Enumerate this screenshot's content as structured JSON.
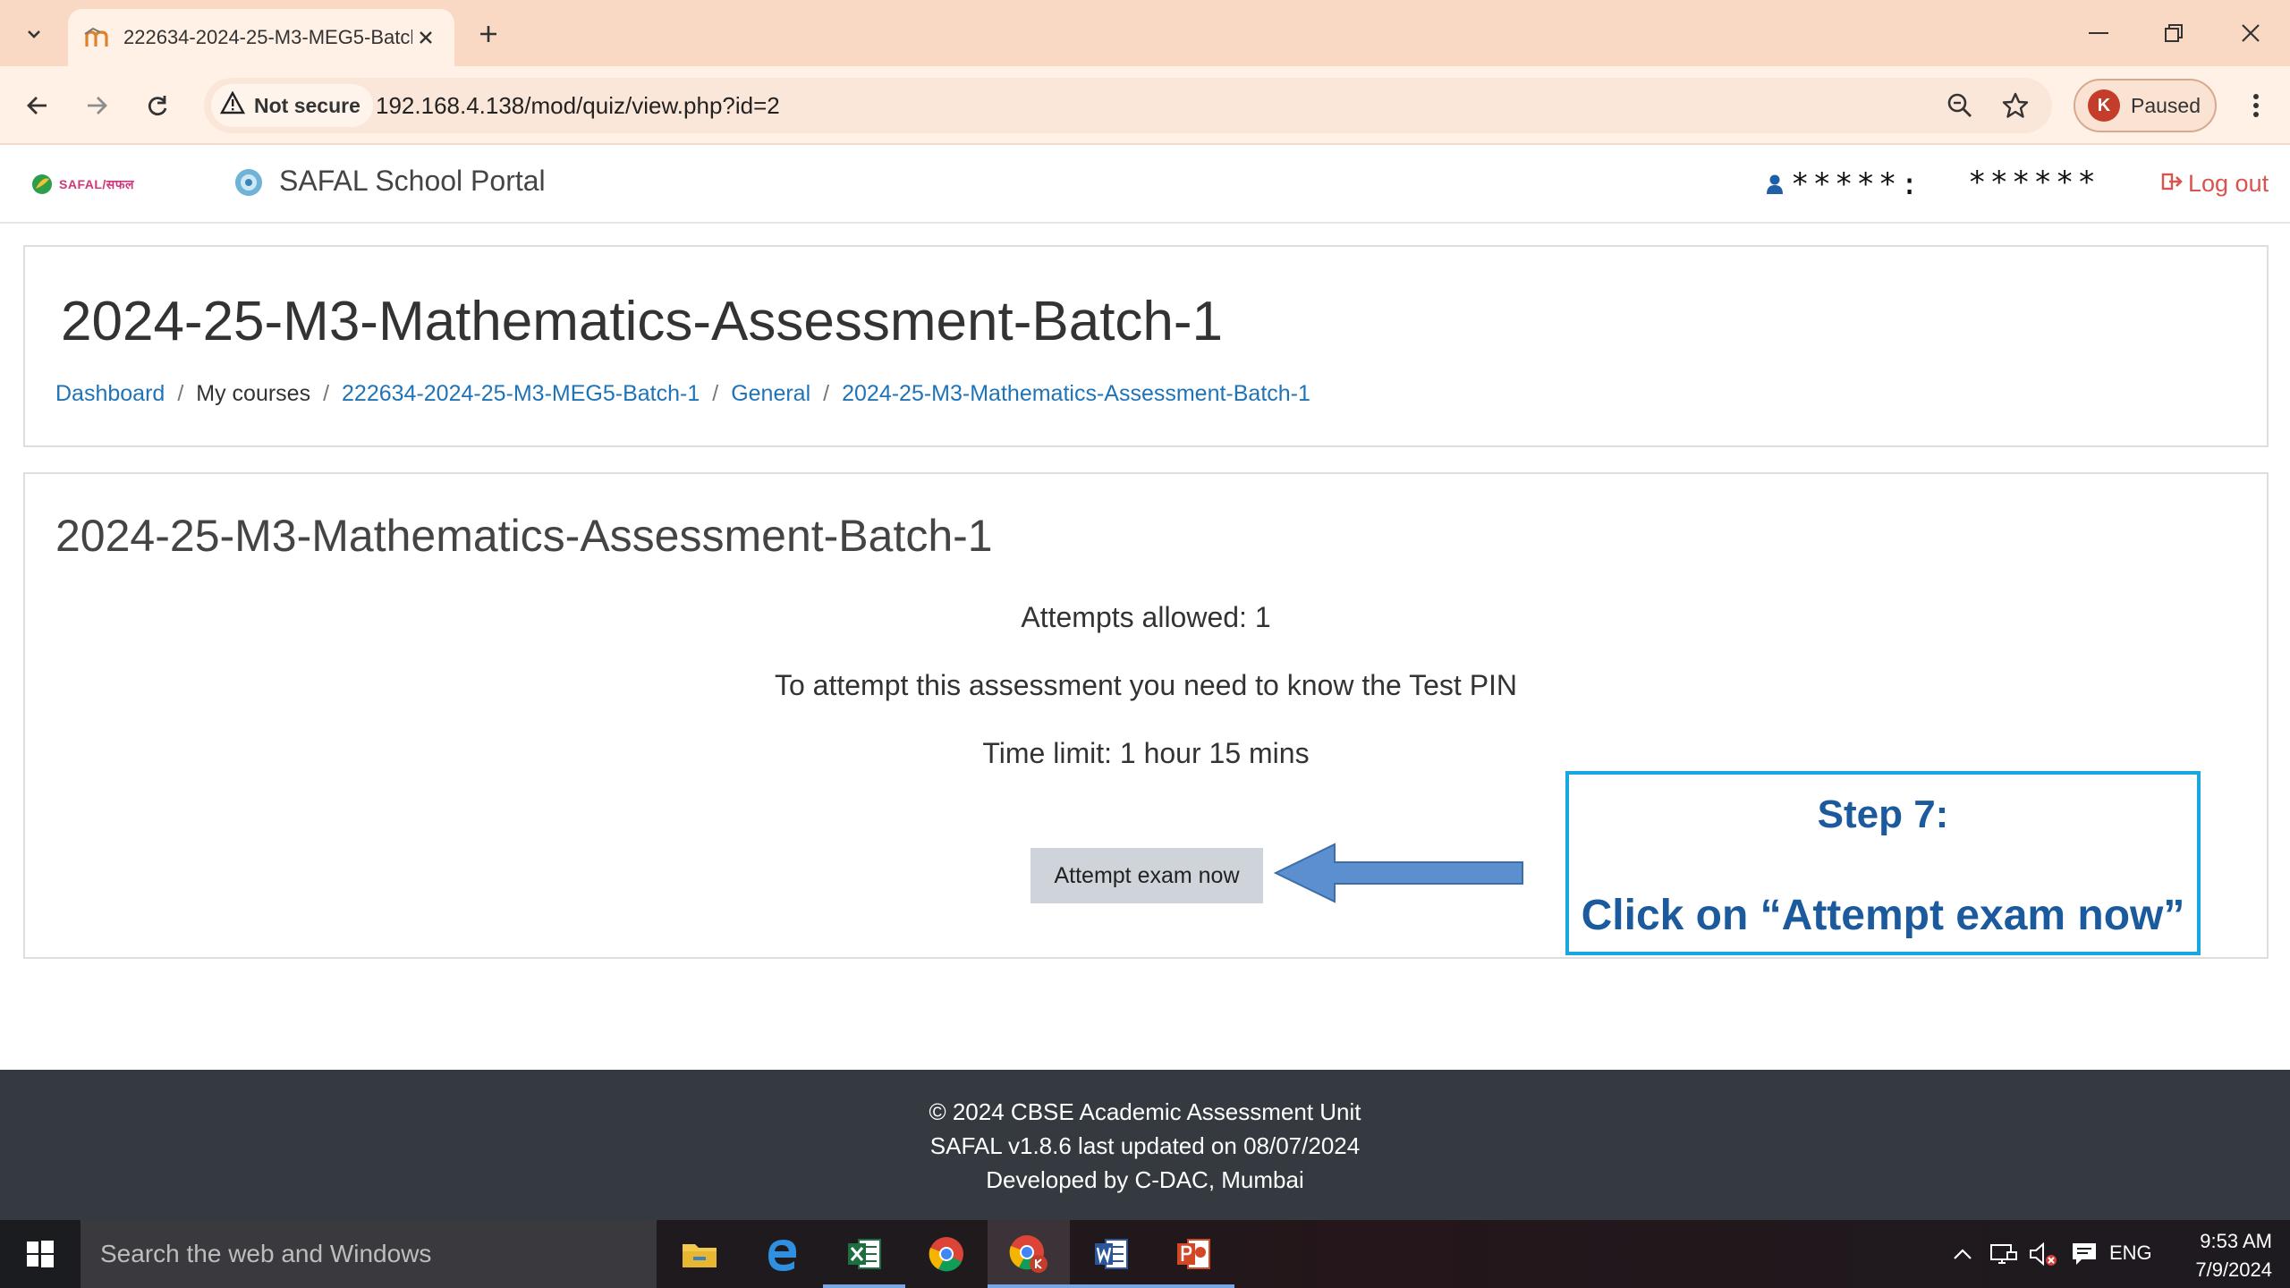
{
  "browser": {
    "tab_title": "222634-2024-25-M3-MEG5-Batch-1",
    "security_label": "Not secure",
    "url": "192.168.4.138/mod/quiz/view.php?id=2",
    "profile_initial": "K",
    "profile_status": "Paused"
  },
  "header": {
    "logo_text": "SAFAL/सफल",
    "portal_name": "SAFAL School Portal",
    "user_name_masked": "*****:",
    "user_id_masked": "******",
    "logout_label": "Log out"
  },
  "page": {
    "heading": "2024-25-M3-Mathematics-Assessment-Batch-1",
    "breadcrumb": [
      {
        "label": "Dashboard",
        "link": true
      },
      {
        "label": "My courses",
        "link": false
      },
      {
        "label": "222634-2024-25-M3-MEG5-Batch-1",
        "link": true
      },
      {
        "label": "General",
        "link": true
      },
      {
        "label": "2024-25-M3-Mathematics-Assessment-Batch-1",
        "link": true
      }
    ],
    "separator": "/"
  },
  "quiz": {
    "title": "2024-25-M3-Mathematics-Assessment-Batch-1",
    "attempts_allowed": "Attempts allowed: 1",
    "pin_notice": "To attempt this assessment you need to know the Test PIN",
    "time_limit": "Time limit: 1 hour 15 mins",
    "attempt_button": "Attempt exam now"
  },
  "annotation": {
    "step_title": "Step 7:",
    "step_body": "Click on “Attempt exam now”",
    "arrow_color": "#5b8fd0",
    "border_color": "#19a7e0",
    "text_color": "#1c5a9e"
  },
  "footer": {
    "copyright": "© 2024 CBSE Academic Assessment Unit",
    "version": "SAFAL v1.8.6 last updated on 08/07/2024",
    "developer": "Developed by C-DAC, Mumbai"
  },
  "taskbar": {
    "search_placeholder": "Search the web and Windows",
    "language": "ENG",
    "time": "9:53 AM",
    "date": "7/9/2024"
  },
  "colors": {
    "link": "#1f73b7",
    "logout": "#d9534f",
    "footer_bg": "#343a40",
    "tab_strip": "#f9d9c4"
  }
}
